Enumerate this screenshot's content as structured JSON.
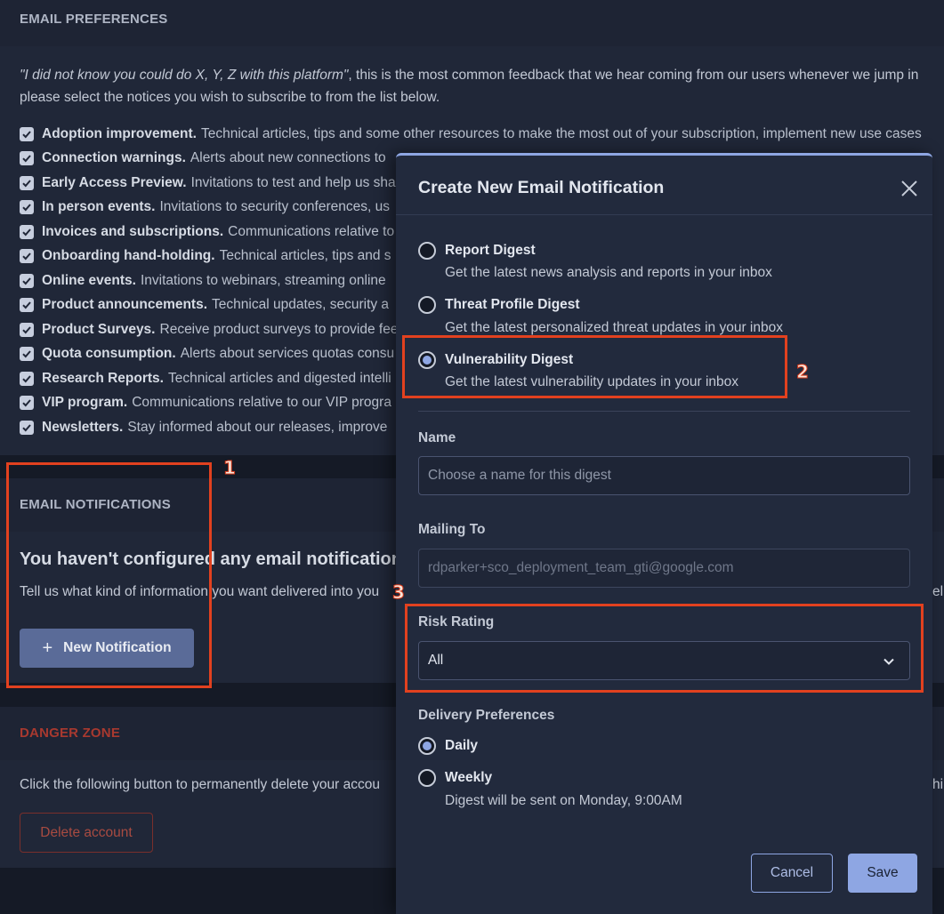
{
  "email_preferences": {
    "header": "EMAIL PREFERENCES",
    "intro_quote": "\"I did not know you could do X, Y, Z with this platform\"",
    "intro_rest": ", this is the most common feedback that we hear coming from our users whenever we jump in",
    "intro_line2": "please select the notices you wish to subscribe to from the list below.",
    "items": [
      {
        "title": "Adoption improvement.",
        "desc": "Technical articles, tips and some other resources to make the most out of your subscription, implement new use cases"
      },
      {
        "title": "Connection warnings.",
        "desc": "Alerts about new connections to"
      },
      {
        "title": "Early Access Preview.",
        "desc": "Invitations to test and help us sha"
      },
      {
        "title": "In person events.",
        "desc": "Invitations to security conferences, us"
      },
      {
        "title": "Invoices and subscriptions.",
        "desc": "Communications relative to"
      },
      {
        "title": "Onboarding hand-holding.",
        "desc": "Technical articles, tips and s"
      },
      {
        "title": "Online events.",
        "desc": "Invitations to webinars, streaming online"
      },
      {
        "title": "Product announcements.",
        "desc": "Technical updates, security a"
      },
      {
        "title": "Product Surveys.",
        "desc": "Receive product surveys to provide fee"
      },
      {
        "title": "Quota consumption.",
        "desc": "Alerts about services quotas consu"
      },
      {
        "title": "Research Reports.",
        "desc": "Technical articles and digested intelli"
      },
      {
        "title": "VIP program.",
        "desc": "Communications relative to our VIP progra"
      },
      {
        "title": "Newsletters.",
        "desc": "Stay informed about our releases, improve"
      }
    ]
  },
  "email_notifications": {
    "header": "EMAIL NOTIFICATIONS",
    "empty_title": "You haven't configured any email notifications",
    "empty_desc": "Tell us what kind of information you want delivered into you",
    "new_button_label": "New Notification",
    "right_cut": "eli"
  },
  "danger_zone": {
    "header": "DANGER ZONE",
    "text": "Click the following button to permanently delete your accou",
    "right_cut": "hi",
    "delete_label": "Delete account"
  },
  "modal": {
    "title": "Create New Email Notification",
    "digest_options": [
      {
        "title": "Report Digest",
        "desc": "Get the latest news analysis and reports in your inbox",
        "selected": false
      },
      {
        "title": "Threat Profile Digest",
        "desc": "Get the latest personalized threat updates in your inbox",
        "selected": false
      },
      {
        "title": "Vulnerability Digest",
        "desc": "Get the latest vulnerability updates in your inbox",
        "selected": true
      }
    ],
    "name_label": "Name",
    "name_placeholder": "Choose a name for this digest",
    "mailing_label": "Mailing To",
    "mailing_value": "rdparker+sco_deployment_team_gti@google.com",
    "risk_label": "Risk Rating",
    "risk_value": "All",
    "delivery_label": "Delivery Preferences",
    "delivery_options": [
      {
        "title": "Daily",
        "selected": true
      },
      {
        "title": "Weekly",
        "desc": "Digest will be sent on Monday, 9:00AM",
        "selected": false
      }
    ],
    "cancel_label": "Cancel",
    "save_label": "Save"
  },
  "annotations": [
    "1",
    "2",
    "3"
  ],
  "colors": {
    "accent": "#8ea6e3",
    "annotation": "#e2411f",
    "danger": "#a84b41"
  }
}
